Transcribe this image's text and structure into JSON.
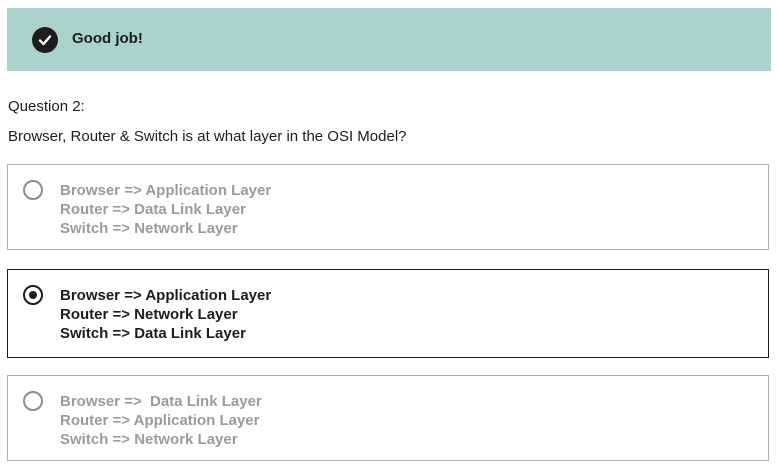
{
  "banner": {
    "icon": "check-circle-icon",
    "text": "Good job!",
    "background": "#acd2cc"
  },
  "question": {
    "number_label": "Question 2:",
    "text": "Browser, Router & Switch is at what layer in the OSI Model?"
  },
  "options": [
    {
      "selected": false,
      "lines": [
        "Browser => Application Layer",
        "Router => Data Link Layer",
        "Switch => Network Layer"
      ]
    },
    {
      "selected": true,
      "lines": [
        "Browser => Application Layer",
        "Router => Network Layer",
        "Switch => Data Link Layer"
      ]
    },
    {
      "selected": false,
      "lines": [
        "Browser =>  Data Link Layer",
        "Router => Application Layer",
        "Switch => Network Layer"
      ]
    }
  ]
}
